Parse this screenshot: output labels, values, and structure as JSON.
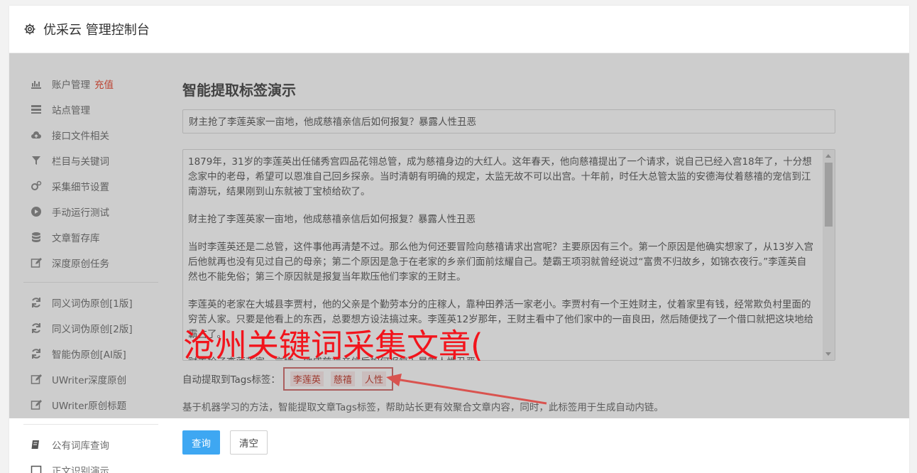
{
  "app": {
    "title": "优采云 管理控制台"
  },
  "sidebar": {
    "group1": [
      {
        "label": "账户管理",
        "badge": "充值",
        "icon": "bar-chart-icon"
      },
      {
        "label": "站点管理",
        "icon": "server-icon"
      },
      {
        "label": "接口文件相关",
        "icon": "cloud-upload-icon"
      },
      {
        "label": "栏目与关键词",
        "icon": "filter-icon"
      },
      {
        "label": "采集细节设置",
        "icon": "gears-icon"
      },
      {
        "label": "手动运行测试",
        "icon": "play-icon"
      },
      {
        "label": "文章暂存库",
        "icon": "database-icon"
      },
      {
        "label": "深度原创任务",
        "icon": "edit-icon"
      }
    ],
    "group2": [
      {
        "label": "同义词伪原创[1版]",
        "icon": "refresh-icon"
      },
      {
        "label": "同义词伪原创[2版]",
        "icon": "refresh-icon"
      },
      {
        "label": "智能伪原创[AI版]",
        "icon": "refresh-icon"
      },
      {
        "label": "UWriter深度原创",
        "icon": "edit-icon"
      },
      {
        "label": "UWriter原创标题",
        "icon": "edit-icon"
      }
    ],
    "group3": [
      {
        "label": "公有词库查询",
        "icon": "book-icon"
      },
      {
        "label": "正文识别演示",
        "icon": "square-icon"
      }
    ]
  },
  "main": {
    "page_title": "智能提取标签演示",
    "title_value": "财主抢了李莲英家一亩地，他成慈禧亲信后如何报复？暴露人性丑恶",
    "article_paragraphs": [
      "1879年，31岁的李莲英出任储秀宫四品花翎总管，成为慈禧身边的大红人。这年春天，他向慈禧提出了一个请求，说自己已经入宫18年了，十分想念家中的老母，希望可以恩准自己回乡探亲。当时清朝有明确的规定，太监无故不可以出宫。十年前，时任大总管太监的安德海仗着慈禧的宠信到江南游玩，结果刚到山东就被丁宝桢给砍了。",
      "财主抢了李莲英家一亩地，他成慈禧亲信后如何报复？暴露人性丑恶",
      "当时李莲英还是二总管，这件事他再清楚不过。那么他为何还要冒险向慈禧请求出宫呢？主要原因有三个。第一个原因是他确实想家了，从13岁入宫后他就再也没有见过自己的母亲；第二个原因是急于在老家的乡亲们面前炫耀自己。楚霸王项羽就曾经说过“富贵不归故乡，如锦衣夜行。”李莲英自然也不能免俗；第三个原因就是报复当年欺压他们李家的王财主。",
      "李莲英的老家在大城县李贾村，他的父亲是个勤劳本分的庄稼人，靠种田养活一家老小。李贾村有一个王姓财主，仗着家里有钱，经常欺负村里面的穷苦人家。只要是他看上的东西，总要想方设法搞过来。李莲英12岁那年，王财主看中了他们家中的一亩良田，然后随便找了一个借口就把这块地给霸占了。",
      "财主抢了李莲英家一亩地，他成慈禧亲信后如何报复？暴露人性丑恶"
    ],
    "tags_label": "自动提取到Tags标签：",
    "tags": [
      "李莲英",
      "慈禧",
      "人性"
    ],
    "description": "基于机器学习的方法，智能提取文章Tags标签，帮助站长更有效聚合文章内容，同时，此标签用于生成自动内链。",
    "query_button": "查询",
    "clear_button": "清空"
  },
  "watermark": {
    "text": "沧州关键词采集文章("
  },
  "colors": {
    "accent": "#3ea7f2",
    "badge": "#e8452e",
    "watermark": "#f2141c",
    "tag_border": "#d26b6b"
  }
}
